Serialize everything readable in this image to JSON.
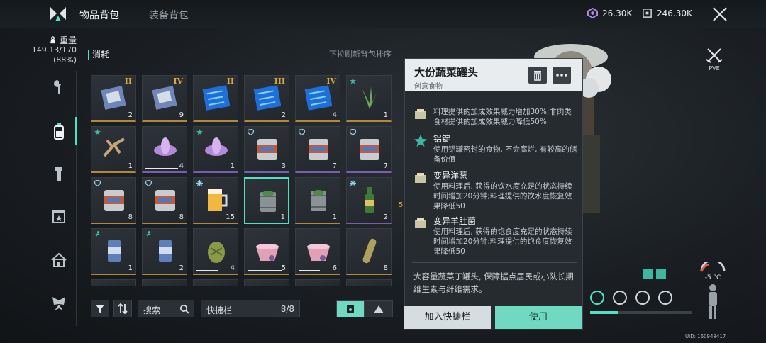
{
  "header": {
    "tabs": [
      {
        "label": "物品背包",
        "active": true
      },
      {
        "label": "装备背包",
        "active": false
      }
    ],
    "currencies": [
      {
        "icon": "crystal-icon",
        "value": "26.30K"
      },
      {
        "icon": "token-icon",
        "value": "246.30K"
      }
    ]
  },
  "weight": {
    "label": "重量",
    "value": "149.13/170",
    "percent": "(88%)"
  },
  "sidebar": {
    "items": [
      {
        "icon": "wrench-icon",
        "active": false
      },
      {
        "icon": "bottle-icon",
        "active": true
      },
      {
        "icon": "flashlight-icon",
        "active": false
      },
      {
        "icon": "calendar-icon",
        "active": false
      },
      {
        "icon": "home-icon",
        "active": false
      },
      {
        "icon": "butterfly-icon",
        "active": false
      }
    ]
  },
  "inventory": {
    "category": "消耗",
    "pull_hint": "下拉刷新背包排序",
    "rows": [
      [
        {
          "name": "blueprint-a",
          "tier": "II",
          "count": "2",
          "rarity": "gold"
        },
        {
          "name": "blueprint-b",
          "tier": "IV",
          "count": "9",
          "rarity": "gold"
        },
        {
          "name": "chip-card-a",
          "tier": "II",
          "count": "",
          "rarity": "gold"
        },
        {
          "name": "chip-card-b",
          "tier": "III",
          "count": "2",
          "rarity": "gold"
        },
        {
          "name": "chip-card-c",
          "tier": "IV",
          "count": "4",
          "rarity": "gold"
        },
        {
          "name": "aloe",
          "tier": "",
          "count": "1",
          "rarity": "gold",
          "badge": "star"
        }
      ],
      [
        {
          "name": "ginseng-root",
          "tier": "",
          "count": "1",
          "rarity": "gold",
          "badge": "star"
        },
        {
          "name": "lotus-flower",
          "tier": "",
          "count": "4",
          "rarity": "purple",
          "durability": 0.85
        },
        {
          "name": "lotus-flower-b",
          "tier": "",
          "count": "1",
          "rarity": "purple",
          "badge": "star"
        },
        {
          "name": "can-a",
          "tier": "",
          "count": "3",
          "rarity": "purple",
          "badge": "shield"
        },
        {
          "name": "can-b",
          "tier": "",
          "count": "7",
          "rarity": "purple",
          "badge": "shield"
        },
        {
          "name": "can-c",
          "tier": "",
          "count": "7",
          "rarity": "purple",
          "badge": "shield"
        }
      ],
      [
        {
          "name": "can-d",
          "tier": "",
          "count": "8",
          "rarity": "gold",
          "badge": "shield"
        },
        {
          "name": "can-e",
          "tier": "",
          "count": "8",
          "rarity": "gold",
          "badge": "shield"
        },
        {
          "name": "beer-mug",
          "tier": "",
          "count": "15",
          "rarity": "gold",
          "badge": "snow"
        },
        {
          "name": "veg-can-selected",
          "tier": "",
          "count": "1",
          "rarity": "gold",
          "selected": true
        },
        {
          "name": "veg-can",
          "tier": "",
          "count": "1",
          "rarity": "gold"
        },
        {
          "name": "wine-bottle",
          "tier": "",
          "count": "2",
          "rarity": "purple",
          "badge": "snow"
        }
      ],
      [
        {
          "name": "energy-can-a",
          "tier": "",
          "count": "1",
          "rarity": "gold",
          "badge": "run"
        },
        {
          "name": "energy-can-b",
          "tier": "",
          "count": "2",
          "rarity": "gold",
          "badge": "run"
        },
        {
          "name": "pinecone",
          "tier": "",
          "count": "4",
          "rarity": "gold",
          "durability": 0.55
        },
        {
          "name": "pink-bowl-a",
          "tier": "",
          "count": "5",
          "rarity": "gold",
          "durability": 0.9
        },
        {
          "name": "pink-bowl-b",
          "tier": "",
          "count": "6",
          "rarity": "gold",
          "durability": 0.55
        },
        {
          "name": "capsule",
          "tier": "",
          "count": "8",
          "rarity": "gold"
        }
      ]
    ]
  },
  "controls": {
    "search_label": "搜索",
    "quickbar_label": "快捷栏",
    "quickbar_value": "8/8"
  },
  "detail": {
    "name": "大份蔬菜罐头",
    "subtitle": "创意食物",
    "effects": [
      {
        "icon": "crate-icon",
        "title": "",
        "desc": "料理提供的加成效果威力增加30%;非肉类食材提供的加成效果威力降低50%"
      },
      {
        "icon": "star-icon",
        "title": "铝锭",
        "desc": "使用铝罐密封的食物, 不会腐烂, 有较高的储备价值"
      },
      {
        "icon": "crate-icon",
        "title": "变异洋葱",
        "desc": "使用料理后, 获得的饮水度充足的状态持续时间增加20分钟;料理提供的饮水度恢复效果降低50"
      },
      {
        "icon": "crate-icon",
        "title": "变异羊肚菌",
        "desc": "使用料理后, 获得的饱食度充足的状态持续时间增加20分钟;料理提供的饱食度恢复效果降低50"
      }
    ],
    "description": "大容量蔬菜丁罐头, 保障据点居民或小队长期维生素与纤维需求。",
    "add_button": "加入快捷栏",
    "use_button": "使用"
  },
  "hud": {
    "mode": "PVE",
    "temperature": "-5 °C",
    "uid": "UID: 160948417",
    "side_marker": "5"
  },
  "colors": {
    "accent": "#4fe0c6",
    "gold": "#b4883a",
    "purple": "#7c5bb5"
  }
}
